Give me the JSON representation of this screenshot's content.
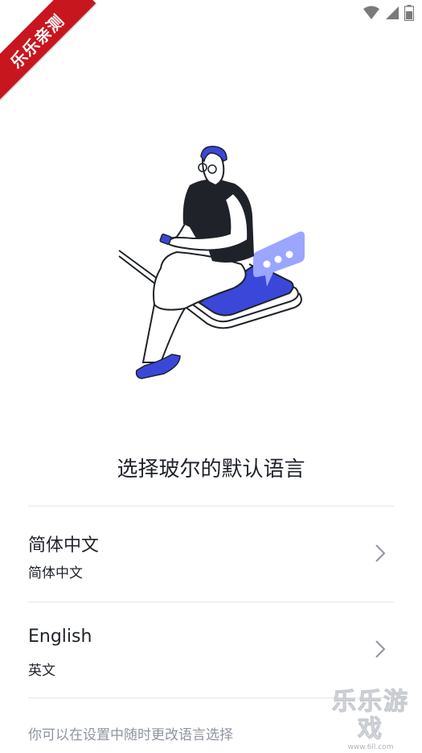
{
  "badge": {
    "text": "乐乐亲测"
  },
  "status_bar": {
    "icons": [
      "wifi-icon",
      "signal-icon",
      "battery-icon"
    ]
  },
  "page": {
    "title": "选择玻尔的默认语言"
  },
  "languages": [
    {
      "name": "简体中文",
      "subtitle": "简体中文"
    },
    {
      "name": "English",
      "subtitle": "英文"
    }
  ],
  "footer": {
    "note": "你可以在设置中随时更改语言选择"
  },
  "watermark": {
    "text": "乐乐游戏",
    "url": "www.6ll.com"
  },
  "colors": {
    "accent": "#3b47d9",
    "accent_light": "#9aa6ff",
    "divider": "#e5e6eb",
    "muted": "#8f959e",
    "badge": "#c8161e"
  }
}
